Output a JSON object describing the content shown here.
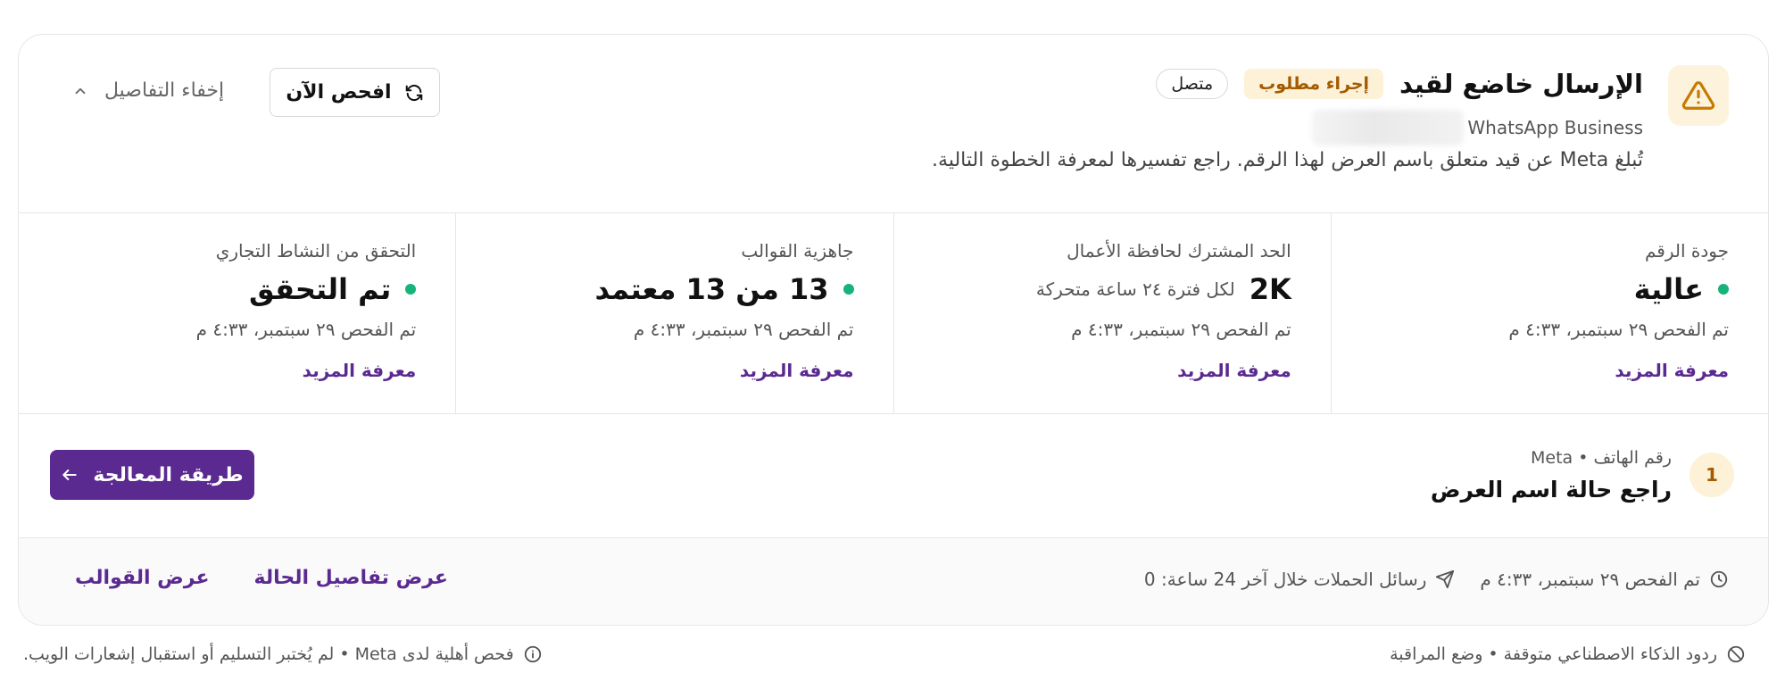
{
  "header": {
    "title": "الإرسال خاضع لقيد",
    "action_badge": "إجراء مطلوب",
    "status_badge": "متصل",
    "subtitle": "WhatsApp Business",
    "description": "تُبلغ Meta عن قيد متعلق باسم العرض لهذا الرقم. راجع تفسيرها لمعرفة الخطوة التالية.",
    "check_now_label": "افحص الآن",
    "hide_details_label": "إخفاء التفاصيل",
    "icons": {
      "warning": "warning-triangle-icon",
      "refresh": "refresh-icon",
      "chevron": "chevron-up-icon"
    },
    "colors": {
      "warning": "#c77a00",
      "warning_bg": "#fdf3dd"
    }
  },
  "metrics": [
    {
      "label": "جودة الرقم",
      "value": "عالية",
      "extra": "",
      "checked": "تم الفحص ٢٩ سبتمبر، ٤:٣٣ م",
      "link": "معرفة المزيد",
      "dot": true
    },
    {
      "label": "الحد المشترك لحافظة الأعمال",
      "value": "2K",
      "extra": "لكل فترة ٢٤ ساعة متحركة",
      "checked": "تم الفحص ٢٩ سبتمبر، ٤:٣٣ م",
      "link": "معرفة المزيد",
      "dot": false
    },
    {
      "label": "جاهزية القوالب",
      "value": "13 من 13 معتمد",
      "extra": "",
      "checked": "تم الفحص ٢٩ سبتمبر، ٤:٣٣ م",
      "link": "معرفة المزيد",
      "dot": true
    },
    {
      "label": "التحقق من النشاط التجاري",
      "value": "تم التحقق",
      "extra": "",
      "checked": "تم الفحص ٢٩ سبتمبر، ٤:٣٣ م",
      "link": "معرفة المزيد",
      "dot": true
    }
  ],
  "step": {
    "number": "1",
    "meta": "رقم الهاتف • Meta",
    "title": "راجع حالة اسم العرض",
    "button_label": "طريقة المعالجة"
  },
  "card_footer": {
    "checked": "تم الفحص ٢٩ سبتمبر، ٤:٣٣ م",
    "campaign": "رسائل الحملات خلال آخر 24 ساعة: 0",
    "status_details_link": "عرض تفاصيل الحالة",
    "templates_link": "عرض القوالب"
  },
  "bottom": {
    "right_text": "ردود الذكاء الاصطناعي متوقفة • وضع المراقبة",
    "left_text": "فحص أهلية لدى Meta • لم يُختبر التسليم أو استقبال إشعارات الويب."
  },
  "colors": {
    "accent": "#5b2a91",
    "success_dot": "#16b37a",
    "border": "#e6e6e6"
  }
}
